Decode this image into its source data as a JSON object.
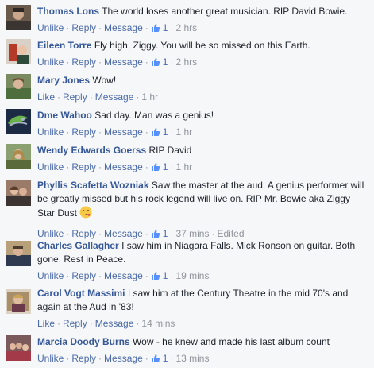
{
  "comments": [
    {
      "name": "Thomas Lons",
      "text": "The world loses another great musician. RIP David Bowie.",
      "action1": "Unlike",
      "reply": "Reply",
      "message": "Message",
      "likes": "1",
      "time": "2 hrs",
      "edited": ""
    },
    {
      "name": "Eileen Torre",
      "text": "Fly high, Ziggy. You will be so missed on this Earth.",
      "action1": "Unlike",
      "reply": "Reply",
      "message": "Message",
      "likes": "1",
      "time": "2 hrs",
      "edited": ""
    },
    {
      "name": "Mary Jones",
      "text": "Wow!",
      "action1": "Like",
      "reply": "Reply",
      "message": "Message",
      "likes": "",
      "time": "1 hr",
      "edited": ""
    },
    {
      "name": "Dme Wahoo",
      "text": "Sad day. Man was a genius!",
      "action1": "Unlike",
      "reply": "Reply",
      "message": "Message",
      "likes": "1",
      "time": "1 hr",
      "edited": ""
    },
    {
      "name": "Wendy Edwards Goerss",
      "text": "RIP David",
      "action1": "Unlike",
      "reply": "Reply",
      "message": "Message",
      "likes": "1",
      "time": "1 hr",
      "edited": ""
    },
    {
      "name": "Phyllis Scafetta Wozniak",
      "text": "Saw the master at the aud. A genius performer will be greatly missed but his rock legend will live on. RIP Mr. Bowie aka Ziggy Star Dust",
      "action1": "Unlike",
      "reply": "Reply",
      "message": "Message",
      "likes": "1",
      "time": "37 mins",
      "edited": "Edited",
      "emoji": "wink-kiss-emoji"
    },
    {
      "name": "Charles Gallagher",
      "text": "I saw him in Niagara Falls. Mick Ronson on guitar. Both gone, Rest in Peace.",
      "action1": "Unlike",
      "reply": "Reply",
      "message": "Message",
      "likes": "1",
      "time": "19 mins",
      "edited": ""
    },
    {
      "name": "Carol Vogt Massimi",
      "text": "I saw him at the Century Theatre in the mid 70's and again at the Aud in '83!",
      "action1": "Like",
      "reply": "Reply",
      "message": "Message",
      "likes": "",
      "time": "14 mins",
      "edited": ""
    },
    {
      "name": "Marcia Doody Burns",
      "text": "Wow - he knew and made his last album count",
      "action1": "Unlike",
      "reply": "Reply",
      "message": "Message",
      "likes": "1",
      "time": "13 mins",
      "edited": ""
    }
  ],
  "icons": {
    "like": "thumbs-up-icon"
  },
  "colors": {
    "name": "#365899",
    "link": "#4b6aa8",
    "meta": "#90949c",
    "background": "#f6f7f9"
  }
}
